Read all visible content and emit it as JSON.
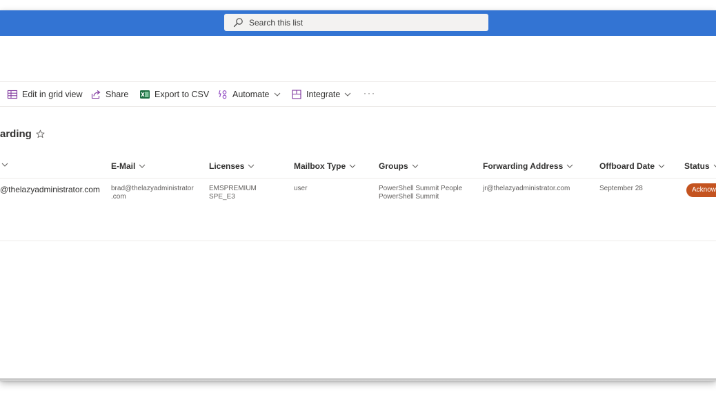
{
  "search": {
    "placeholder": "Search this list"
  },
  "command_bar": {
    "edit_grid": "Edit in grid view",
    "share": "Share",
    "export_csv": "Export to CSV",
    "automate": "Automate",
    "integrate": "Integrate",
    "more": "···"
  },
  "list": {
    "title": "arding"
  },
  "columns": {
    "title": "",
    "email": "E-Mail",
    "licenses": "Licenses",
    "mailbox_type": "Mailbox Type",
    "groups": "Groups",
    "forwarding_address": "Forwarding Address",
    "offboard_date": "Offboard Date",
    "status": "Status"
  },
  "rows": [
    {
      "title": "@thelazyadministrator.com",
      "email_line1": "brad@thelazyadministrator",
      "email_line2": ".com",
      "licenses_line1": "EMSPREMIUM",
      "licenses_line2": "SPE_E3",
      "mailbox_type": "user",
      "groups_line1": "PowerShell Summit People",
      "groups_line2": "PowerShell Summit",
      "forwarding_address": "jr@thelazyadministrator.com",
      "offboard_date": "September 28",
      "status": "Acknowledged"
    }
  ],
  "colors": {
    "suite_bar": "#3374d3",
    "status_pill": "#c4531f",
    "automate_icon": "#8a3fbf",
    "excel_green": "#1d6f42"
  },
  "icons": {
    "search": "search-icon",
    "grid": "grid-icon",
    "share": "share-icon",
    "excel": "excel-icon",
    "automate": "automate-icon",
    "integrate": "integrate-icon",
    "star": "star-icon",
    "chevron": "chevron-down-icon"
  }
}
